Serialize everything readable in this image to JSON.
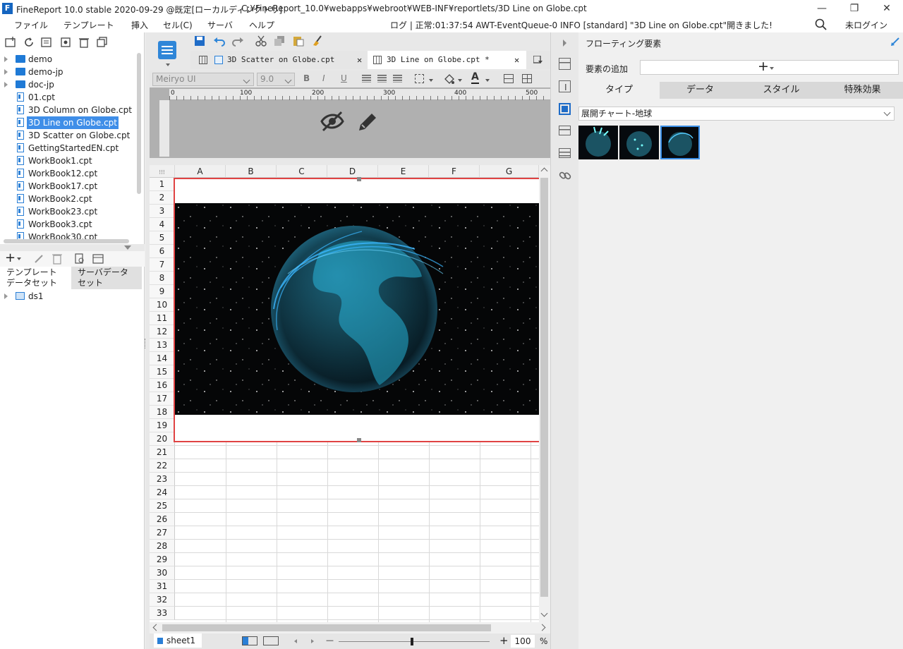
{
  "window": {
    "title": "FineReport 10.0 stable 2020-09-29 @既定[ローカルディレクトリ]",
    "path": "C:¥FineReport_10.0¥webapps¥webroot¥WEB-INF¥reportlets/3D Line on Globe.cpt",
    "minimize": "—",
    "restore": "❐",
    "close": "✕"
  },
  "menu": [
    "ファイル",
    "テンプレート",
    "挿入",
    "セル(C)",
    "サーバ",
    "ヘルプ"
  ],
  "status_log": "ログ | 正常:01:37:54 AWT-EventQueue-0 INFO [standard] \"3D Line on Globe.cpt\"開きました!",
  "login": "未ログイン",
  "file_tree": [
    {
      "label": "demo",
      "kind": "folder"
    },
    {
      "label": "demo-jp",
      "kind": "folder"
    },
    {
      "label": "doc-jp",
      "kind": "folder"
    },
    {
      "label": "01.cpt",
      "kind": "file"
    },
    {
      "label": "3D Column on Globe.cpt",
      "kind": "file"
    },
    {
      "label": "3D Line on Globe.cpt",
      "kind": "file"
    },
    {
      "label": "3D Scatter on Globe.cpt",
      "kind": "file"
    },
    {
      "label": "GettingStartedEN.cpt",
      "kind": "file"
    },
    {
      "label": "WorkBook1.cpt",
      "kind": "file"
    },
    {
      "label": "WorkBook12.cpt",
      "kind": "file"
    },
    {
      "label": "WorkBook17.cpt",
      "kind": "file"
    },
    {
      "label": "WorkBook2.cpt",
      "kind": "file"
    },
    {
      "label": "WorkBook23.cpt",
      "kind": "file"
    },
    {
      "label": "WorkBook3.cpt",
      "kind": "file"
    },
    {
      "label": "WorkBook30.cpt",
      "kind": "file"
    }
  ],
  "dataset_tabs": [
    "テンプレート データセット",
    "サーバデータ セット"
  ],
  "datasets": [
    "ds1"
  ],
  "tabs": [
    "3D Scatter on Globe.cpt",
    "3D Line on Globe.cpt *"
  ],
  "format": {
    "font": "Meiryo UI",
    "size": "9.0",
    "bold": "B",
    "italic": "I",
    "underline": "U",
    "font_color": "A"
  },
  "ruler_ticks": [
    "0",
    "100",
    "200",
    "300",
    "400",
    "500"
  ],
  "columns": [
    "A",
    "B",
    "C",
    "D",
    "E",
    "F",
    "G"
  ],
  "rows": [
    "1",
    "2",
    "3",
    "4",
    "5",
    "6",
    "7",
    "8",
    "9",
    "10",
    "11",
    "12",
    "13",
    "14",
    "15",
    "16",
    "17",
    "18",
    "19",
    "20",
    "21",
    "22",
    "23",
    "24",
    "25",
    "26",
    "27",
    "28",
    "29",
    "30",
    "31",
    "32",
    "33"
  ],
  "sheet": {
    "name": "sheet1",
    "zoom": "100",
    "percent": "%",
    "minus": "—",
    "plus": "+"
  },
  "right_panel": {
    "title": "フローティング要素",
    "add_label": "要素の追加",
    "tabs": [
      "タイプ",
      "データ",
      "スタイル",
      "特殊効果"
    ],
    "chart_type": "展開チャート-地球",
    "thumb_count": 3,
    "selected_thumb": 3
  }
}
